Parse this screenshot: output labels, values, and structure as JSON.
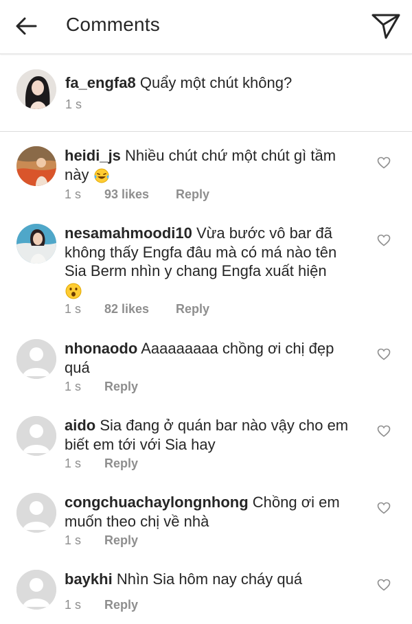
{
  "header": {
    "title": "Comments",
    "back_icon": "arrow-left-icon",
    "send_icon": "paper-plane-icon"
  },
  "caption": {
    "username": "fa_engfa8",
    "text": "Quẩy một chút không?",
    "time": "1 s"
  },
  "comments": [
    {
      "username": "heidi_js",
      "text": "Nhiều chút chứ một chút gì tầm này",
      "emoji": "laughing-tears-emoji",
      "time": "1 s",
      "likes": "93 likes",
      "reply": "Reply"
    },
    {
      "username": "nesamahmoodi10",
      "text": "Vừa bước vô bar đã không thấy Engfa đâu mà có má nào tên Sia Berm nhìn y chang Engfa xuất hiện",
      "emoji": "surprised-face-emoji",
      "time": "1 s",
      "likes": "82 likes",
      "reply": "Reply"
    },
    {
      "username": "nhonaodo",
      "text": "Aaaaaaaaa chồng ơi chị đẹp quá",
      "time": "1 s",
      "reply": "Reply"
    },
    {
      "username": "aido",
      "text": "Sia đang ở quán bar nào vậy cho em biết em tới với Sia hay",
      "time": "1 s",
      "reply": "Reply"
    },
    {
      "username": "congchuachaylongnhong",
      "text": "Chồng ơi em muốn theo chị về nhà",
      "time": "1 s",
      "reply": "Reply"
    },
    {
      "username": "baykhi",
      "text": "Nhìn Sia hôm nay cháy quá",
      "time": "1 s",
      "reply": "Reply"
    }
  ],
  "colors": {
    "text": "#262626",
    "muted": "#8e8e8e",
    "divider": "#dbdbdb",
    "avatar_placeholder": "#dcdcdc"
  }
}
